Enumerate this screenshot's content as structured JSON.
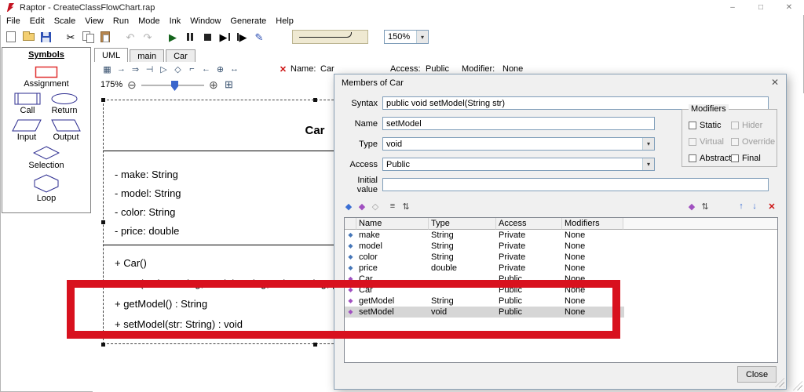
{
  "window": {
    "title": "Raptor - CreateClassFlowChart.rap",
    "minimize": "–",
    "maximize": "□",
    "close": "✕"
  },
  "menu": {
    "items": [
      "File",
      "Edit",
      "Scale",
      "View",
      "Run",
      "Mode",
      "Ink",
      "Window",
      "Generate",
      "Help"
    ]
  },
  "icons": {
    "cut": "✂",
    "undo": "↶",
    "redo": "↷",
    "run": "▶",
    "pen": "✎",
    "step_forward": "▶",
    "step_end": "▶",
    "arrow_down": "▾",
    "lens_minus": "⊖",
    "lens_plus": "⊕",
    "fit": "⊞",
    "uml": [
      "▦",
      "→",
      "⇒",
      "⊣",
      "▷",
      "◇",
      "⌐",
      "←",
      "⊕",
      "↔"
    ],
    "delete": "✕"
  },
  "toolbar": {
    "zoom_value": "150%"
  },
  "symbols": {
    "title": "Symbols",
    "labels": {
      "assignment": "Assignment",
      "call": "Call",
      "return": "Return",
      "input": "Input",
      "output": "Output",
      "selection": "Selection",
      "loop": "Loop"
    }
  },
  "tabs": {
    "items": [
      "UML",
      "main",
      "Car"
    ]
  },
  "uml_toolbar": {
    "name_label": "Name:",
    "name_value": "Car",
    "access_label": "Access:",
    "access_value": "Public",
    "modifier_label": "Modifier:",
    "modifier_value": "None"
  },
  "zoom_bar": {
    "value": "175%"
  },
  "diagram": {
    "title": "Car",
    "attributes": [
      "- make: String",
      "- model: String",
      "- color: String",
      "- price: double"
    ],
    "methods": [
      "+ Car()",
      "+ Car(make: String, model: String, color: String, price: double)",
      "+ getModel() : String",
      "+ setModel(str: String) : void"
    ]
  },
  "dialog": {
    "title": "Members of Car",
    "close_icon": "✕",
    "fields": {
      "syntax_label": "Syntax",
      "syntax_value": "public void setModel(String str)",
      "name_label": "Name",
      "name_value": "setModel",
      "type_label": "Type",
      "type_value": "void",
      "access_label": "Access",
      "access_value": "Public",
      "initial_label": "Initial value",
      "initial_value": ""
    },
    "modifiers": {
      "title": "Modifiers",
      "options": [
        {
          "label": "Static"
        },
        {
          "label": "Hider"
        },
        {
          "label": "Virtual"
        },
        {
          "label": "Override"
        },
        {
          "label": "Abstract"
        },
        {
          "label": "Final"
        }
      ]
    },
    "toolbar_icons": {
      "left": [
        "◆",
        "◆",
        "◇",
        "≡",
        "⇅"
      ],
      "right": [
        "◆",
        "⇅",
        "↑",
        "↓"
      ],
      "delete": "✕"
    },
    "row_icon": "◆",
    "table": {
      "columns": [
        "Name",
        "Type",
        "Access",
        "Modifiers"
      ],
      "rows": [
        {
          "name": "make",
          "type": "String",
          "access": "Private",
          "modifiers": "None"
        },
        {
          "name": "model",
          "type": "String",
          "access": "Private",
          "modifiers": "None"
        },
        {
          "name": "color",
          "type": "String",
          "access": "Private",
          "modifiers": "None"
        },
        {
          "name": "price",
          "type": "double",
          "access": "Private",
          "modifiers": "None"
        },
        {
          "name": "Car",
          "type": "",
          "access": "Public",
          "modifiers": "None"
        },
        {
          "name": "Car",
          "type": "",
          "access": "Public",
          "modifiers": "None"
        },
        {
          "name": "getModel",
          "type": "String",
          "access": "Public",
          "modifiers": "None"
        },
        {
          "name": "setModel",
          "type": "void",
          "access": "Public",
          "modifiers": "None"
        }
      ]
    },
    "close_label": "Close"
  }
}
